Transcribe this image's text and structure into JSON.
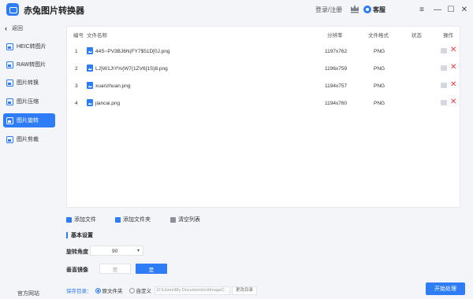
{
  "app": {
    "title": "赤兔图片转换器",
    "login": "登录/注册",
    "service": "客服",
    "minimize": "—",
    "maximize": "☐",
    "close": "✕"
  },
  "sidebar": {
    "back_label": "返回",
    "items": [
      {
        "label": "HEIC转图片"
      },
      {
        "label": "RAW转图片"
      },
      {
        "label": "图片转换"
      },
      {
        "label": "图片压缩"
      },
      {
        "label": "图片旋转"
      },
      {
        "label": "图片剪裁"
      }
    ],
    "active_index": 4,
    "footer": "官方网站"
  },
  "table": {
    "headers": {
      "index": "编号",
      "name": "文件名称",
      "resolution": "分辨率",
      "format": "文件格式",
      "status": "状态",
      "action": "操作"
    },
    "rows": [
      {
        "index": "1",
        "name": "44S~PV3BJ6N(FY7$51D[0J.png",
        "resolution": "1197x762",
        "format": "PNG",
        "status": ""
      },
      {
        "index": "2",
        "name": "LJ}W1J\\Y%{W7(1ZV6[1S}8.png",
        "resolution": "1196x759",
        "format": "PNG",
        "status": ""
      },
      {
        "index": "3",
        "name": "xuanzhuan.png",
        "resolution": "1194x757",
        "format": "PNG",
        "status": ""
      },
      {
        "index": "4",
        "name": "jiancai.png",
        "resolution": "1194x760",
        "format": "PNG",
        "status": ""
      }
    ]
  },
  "toolbar": {
    "add_file": "添加文件",
    "add_folder": "添加文件夹",
    "clear_list": "清空列表"
  },
  "settings": {
    "section_title": "基本设置",
    "angle_label": "旋转角度",
    "angle_value": "90",
    "mirror_label": "垂直镜像",
    "no_label": "否",
    "yes_label": "是"
  },
  "save": {
    "label": "保存目录：",
    "option_original": "原文件夹",
    "option_custom": "自定义",
    "path": "D:\\Users\\My Documents\\citImageC",
    "change_button": "更改目录",
    "selected": "original"
  },
  "start_button": "开始处理",
  "colors": {
    "accent": "#2f7df6",
    "delete": "#e83b3b"
  }
}
